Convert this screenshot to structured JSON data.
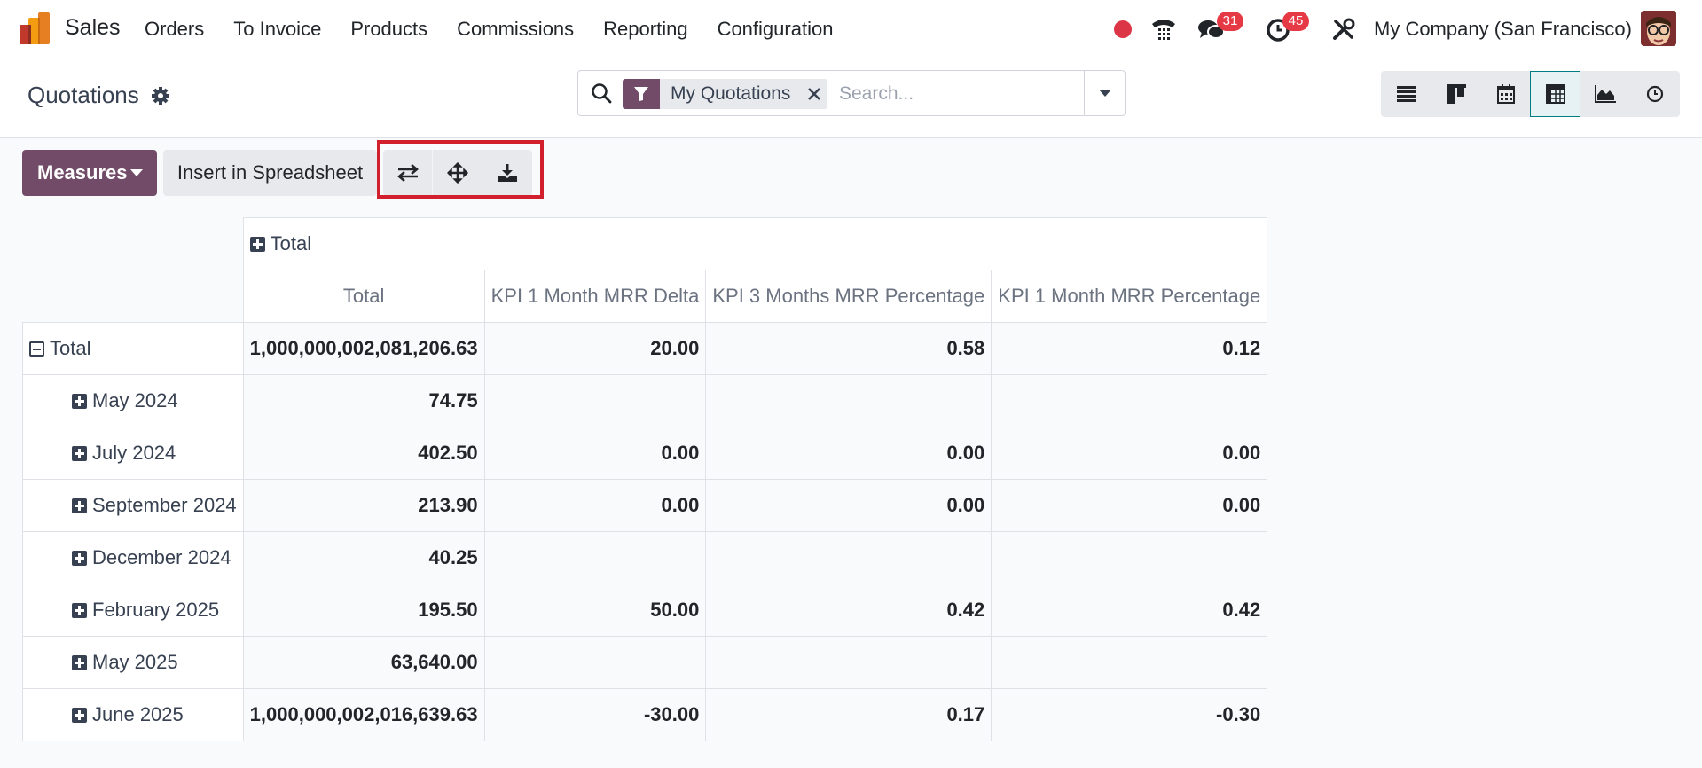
{
  "navbar": {
    "brand": "Sales",
    "menu": [
      "Orders",
      "To Invoice",
      "Products",
      "Commissions",
      "Reporting",
      "Configuration"
    ],
    "messages_badge": "31",
    "activities_badge": "45",
    "company": "My Company (San Francisco)"
  },
  "control_panel": {
    "title": "Quotations",
    "facet_label": "My Quotations",
    "search_placeholder": "Search..."
  },
  "toolbar": {
    "measures_label": "Measures",
    "insert_label": "Insert in Spreadsheet"
  },
  "pivot": {
    "col_group_header": "Total",
    "columns": [
      "Total",
      "KPI 1 Month MRR Delta",
      "KPI 3 Months MRR Percentage",
      "KPI 1 Month MRR Percentage"
    ],
    "total_row": {
      "label": "Total",
      "values": [
        "1,000,000,002,081,206.63",
        "20.00",
        "0.58",
        "0.12"
      ]
    },
    "rows": [
      {
        "label": "May 2024",
        "values": [
          "74.75",
          "",
          "",
          ""
        ]
      },
      {
        "label": "July 2024",
        "values": [
          "402.50",
          "0.00",
          "0.00",
          "0.00"
        ]
      },
      {
        "label": "September 2024",
        "values": [
          "213.90",
          "0.00",
          "0.00",
          "0.00"
        ]
      },
      {
        "label": "December 2024",
        "values": [
          "40.25",
          "",
          "",
          ""
        ]
      },
      {
        "label": "February 2025",
        "values": [
          "195.50",
          "50.00",
          "0.42",
          "0.42"
        ]
      },
      {
        "label": "May 2025",
        "values": [
          "63,640.00",
          "",
          "",
          ""
        ]
      },
      {
        "label": "June 2025",
        "values": [
          "1,000,000,002,016,639.63",
          "-30.00",
          "0.17",
          "-0.30"
        ]
      }
    ]
  },
  "colors": {
    "brand": "#714b67",
    "highlight": "#d21f2e",
    "badge": "#e63946",
    "active_view": "#017e84"
  }
}
